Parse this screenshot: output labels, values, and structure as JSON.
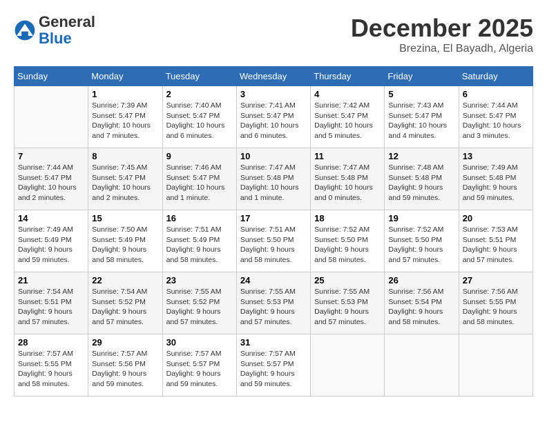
{
  "header": {
    "logo_general": "General",
    "logo_blue": "Blue",
    "month_title": "December 2025",
    "location": "Brezina, El Bayadh, Algeria"
  },
  "days_of_week": [
    "Sunday",
    "Monday",
    "Tuesday",
    "Wednesday",
    "Thursday",
    "Friday",
    "Saturday"
  ],
  "weeks": [
    [
      {
        "day": "",
        "info": ""
      },
      {
        "day": "1",
        "info": "Sunrise: 7:39 AM\nSunset: 5:47 PM\nDaylight: 10 hours\nand 7 minutes."
      },
      {
        "day": "2",
        "info": "Sunrise: 7:40 AM\nSunset: 5:47 PM\nDaylight: 10 hours\nand 6 minutes."
      },
      {
        "day": "3",
        "info": "Sunrise: 7:41 AM\nSunset: 5:47 PM\nDaylight: 10 hours\nand 6 minutes."
      },
      {
        "day": "4",
        "info": "Sunrise: 7:42 AM\nSunset: 5:47 PM\nDaylight: 10 hours\nand 5 minutes."
      },
      {
        "day": "5",
        "info": "Sunrise: 7:43 AM\nSunset: 5:47 PM\nDaylight: 10 hours\nand 4 minutes."
      },
      {
        "day": "6",
        "info": "Sunrise: 7:44 AM\nSunset: 5:47 PM\nDaylight: 10 hours\nand 3 minutes."
      }
    ],
    [
      {
        "day": "7",
        "info": "Sunrise: 7:44 AM\nSunset: 5:47 PM\nDaylight: 10 hours\nand 2 minutes."
      },
      {
        "day": "8",
        "info": "Sunrise: 7:45 AM\nSunset: 5:47 PM\nDaylight: 10 hours\nand 2 minutes."
      },
      {
        "day": "9",
        "info": "Sunrise: 7:46 AM\nSunset: 5:47 PM\nDaylight: 10 hours\nand 1 minute."
      },
      {
        "day": "10",
        "info": "Sunrise: 7:47 AM\nSunset: 5:48 PM\nDaylight: 10 hours\nand 1 minute."
      },
      {
        "day": "11",
        "info": "Sunrise: 7:47 AM\nSunset: 5:48 PM\nDaylight: 10 hours\nand 0 minutes."
      },
      {
        "day": "12",
        "info": "Sunrise: 7:48 AM\nSunset: 5:48 PM\nDaylight: 9 hours\nand 59 minutes."
      },
      {
        "day": "13",
        "info": "Sunrise: 7:49 AM\nSunset: 5:48 PM\nDaylight: 9 hours\nand 59 minutes."
      }
    ],
    [
      {
        "day": "14",
        "info": "Sunrise: 7:49 AM\nSunset: 5:49 PM\nDaylight: 9 hours\nand 59 minutes."
      },
      {
        "day": "15",
        "info": "Sunrise: 7:50 AM\nSunset: 5:49 PM\nDaylight: 9 hours\nand 58 minutes."
      },
      {
        "day": "16",
        "info": "Sunrise: 7:51 AM\nSunset: 5:49 PM\nDaylight: 9 hours\nand 58 minutes."
      },
      {
        "day": "17",
        "info": "Sunrise: 7:51 AM\nSunset: 5:50 PM\nDaylight: 9 hours\nand 58 minutes."
      },
      {
        "day": "18",
        "info": "Sunrise: 7:52 AM\nSunset: 5:50 PM\nDaylight: 9 hours\nand 58 minutes."
      },
      {
        "day": "19",
        "info": "Sunrise: 7:52 AM\nSunset: 5:50 PM\nDaylight: 9 hours\nand 57 minutes."
      },
      {
        "day": "20",
        "info": "Sunrise: 7:53 AM\nSunset: 5:51 PM\nDaylight: 9 hours\nand 57 minutes."
      }
    ],
    [
      {
        "day": "21",
        "info": "Sunrise: 7:54 AM\nSunset: 5:51 PM\nDaylight: 9 hours\nand 57 minutes."
      },
      {
        "day": "22",
        "info": "Sunrise: 7:54 AM\nSunset: 5:52 PM\nDaylight: 9 hours\nand 57 minutes."
      },
      {
        "day": "23",
        "info": "Sunrise: 7:55 AM\nSunset: 5:52 PM\nDaylight: 9 hours\nand 57 minutes."
      },
      {
        "day": "24",
        "info": "Sunrise: 7:55 AM\nSunset: 5:53 PM\nDaylight: 9 hours\nand 57 minutes."
      },
      {
        "day": "25",
        "info": "Sunrise: 7:55 AM\nSunset: 5:53 PM\nDaylight: 9 hours\nand 57 minutes."
      },
      {
        "day": "26",
        "info": "Sunrise: 7:56 AM\nSunset: 5:54 PM\nDaylight: 9 hours\nand 58 minutes."
      },
      {
        "day": "27",
        "info": "Sunrise: 7:56 AM\nSunset: 5:55 PM\nDaylight: 9 hours\nand 58 minutes."
      }
    ],
    [
      {
        "day": "28",
        "info": "Sunrise: 7:57 AM\nSunset: 5:55 PM\nDaylight: 9 hours\nand 58 minutes."
      },
      {
        "day": "29",
        "info": "Sunrise: 7:57 AM\nSunset: 5:56 PM\nDaylight: 9 hours\nand 59 minutes."
      },
      {
        "day": "30",
        "info": "Sunrise: 7:57 AM\nSunset: 5:57 PM\nDaylight: 9 hours\nand 59 minutes."
      },
      {
        "day": "31",
        "info": "Sunrise: 7:57 AM\nSunset: 5:57 PM\nDaylight: 9 hours\nand 59 minutes."
      },
      {
        "day": "",
        "info": ""
      },
      {
        "day": "",
        "info": ""
      },
      {
        "day": "",
        "info": ""
      }
    ]
  ]
}
